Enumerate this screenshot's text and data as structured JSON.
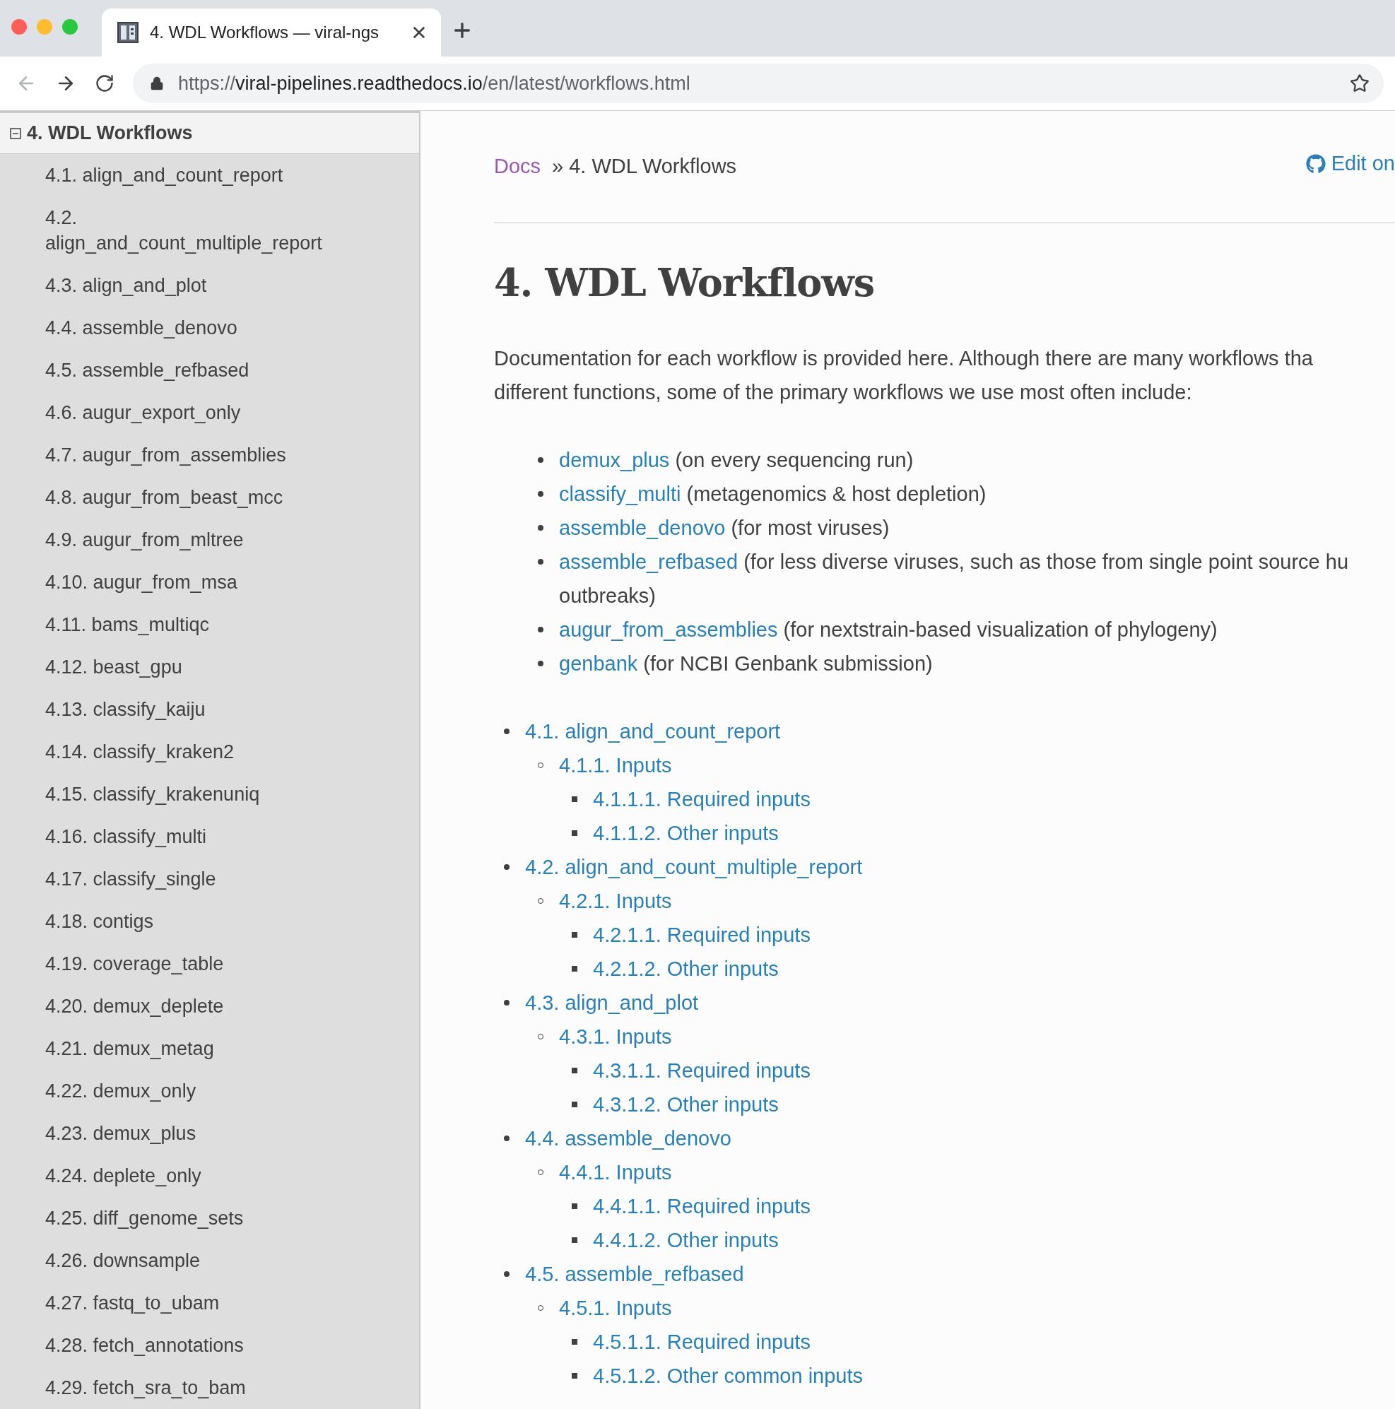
{
  "browser": {
    "tab_title": "4. WDL Workflows — viral-ngs",
    "url": {
      "scheme": "https://",
      "host": "viral-pipelines.readthedocs.io",
      "path": "/en/latest/workflows.html"
    }
  },
  "sidebar": {
    "header": "4. WDL Workflows",
    "expanded": true,
    "items": [
      {
        "label": "4.1. align_and_count_report"
      },
      {
        "label": "4.2. align_and_count_multiple_report"
      },
      {
        "label": "4.3. align_and_plot"
      },
      {
        "label": "4.4. assemble_denovo"
      },
      {
        "label": "4.5. assemble_refbased"
      },
      {
        "label": "4.6. augur_export_only"
      },
      {
        "label": "4.7. augur_from_assemblies"
      },
      {
        "label": "4.8. augur_from_beast_mcc"
      },
      {
        "label": "4.9. augur_from_mltree"
      },
      {
        "label": "4.10. augur_from_msa"
      },
      {
        "label": "4.11. bams_multiqc"
      },
      {
        "label": "4.12. beast_gpu"
      },
      {
        "label": "4.13. classify_kaiju"
      },
      {
        "label": "4.14. classify_kraken2"
      },
      {
        "label": "4.15. classify_krakenuniq"
      },
      {
        "label": "4.16. classify_multi"
      },
      {
        "label": "4.17. classify_single"
      },
      {
        "label": "4.18. contigs"
      },
      {
        "label": "4.19. coverage_table"
      },
      {
        "label": "4.20. demux_deplete"
      },
      {
        "label": "4.21. demux_metag"
      },
      {
        "label": "4.22. demux_only"
      },
      {
        "label": "4.23. demux_plus"
      },
      {
        "label": "4.24. deplete_only"
      },
      {
        "label": "4.25. diff_genome_sets"
      },
      {
        "label": "4.26. downsample"
      },
      {
        "label": "4.27. fastq_to_ubam"
      },
      {
        "label": "4.28. fetch_annotations"
      },
      {
        "label": "4.29. fetch_sra_to_bam"
      }
    ]
  },
  "breadcrumb": {
    "link": "Docs",
    "separator": "»",
    "current": "4. WDL Workflows",
    "edit_link": "Edit on"
  },
  "title": "4. WDL Workflows",
  "intro": "Documentation for each workflow is provided here. Although there are many workflows tha\ndifferent functions, some of the primary workflows we use most often include:",
  "highlights": [
    {
      "link": "demux_plus",
      "note": "(on every sequencing run)"
    },
    {
      "link": "classify_multi",
      "note": "(metagenomics & host depletion)"
    },
    {
      "link": "assemble_denovo",
      "note": "(for most viruses)"
    },
    {
      "link": "assemble_refbased",
      "note": "(for less diverse viruses, such as those from single point source hu\noutbreaks)"
    },
    {
      "link": "augur_from_assemblies",
      "note": "(for nextstrain-based visualization of phylogeny)"
    },
    {
      "link": "genbank",
      "note": "(for NCBI Genbank submission)"
    }
  ],
  "toc": [
    {
      "label": "4.1. align_and_count_report",
      "children": [
        {
          "label": "4.1.1. Inputs",
          "children": [
            {
              "label": "4.1.1.1. Required inputs"
            },
            {
              "label": "4.1.1.2. Other inputs"
            }
          ]
        }
      ]
    },
    {
      "label": "4.2. align_and_count_multiple_report",
      "children": [
        {
          "label": "4.2.1. Inputs",
          "children": [
            {
              "label": "4.2.1.1. Required inputs"
            },
            {
              "label": "4.2.1.2. Other inputs"
            }
          ]
        }
      ]
    },
    {
      "label": "4.3. align_and_plot",
      "children": [
        {
          "label": "4.3.1. Inputs",
          "children": [
            {
              "label": "4.3.1.1. Required inputs"
            },
            {
              "label": "4.3.1.2. Other inputs"
            }
          ]
        }
      ]
    },
    {
      "label": "4.4. assemble_denovo",
      "children": [
        {
          "label": "4.4.1. Inputs",
          "children": [
            {
              "label": "4.4.1.1. Required inputs"
            },
            {
              "label": "4.4.1.2. Other inputs"
            }
          ]
        }
      ]
    },
    {
      "label": "4.5. assemble_refbased",
      "children": [
        {
          "label": "4.5.1. Inputs",
          "children": [
            {
              "label": "4.5.1.1. Required inputs"
            },
            {
              "label": "4.5.1.2. Other common inputs"
            }
          ]
        }
      ]
    }
  ]
}
